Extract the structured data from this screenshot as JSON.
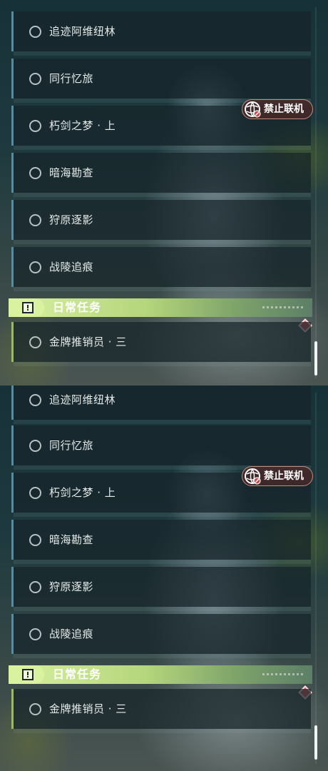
{
  "panels": [
    {
      "quests": [
        {
          "label": "追迹阿维纽林"
        },
        {
          "label": "同行忆旅"
        },
        {
          "label": "朽剑之梦 · 上"
        },
        {
          "label": "暗海勘查"
        },
        {
          "label": "狩原逐影"
        },
        {
          "label": "战陵追痕"
        }
      ],
      "badge": {
        "label": "禁止联机",
        "icon": "globe-block-icon"
      },
      "daily": {
        "title": "日常任务",
        "icon": "alert-square-icon",
        "quests": [
          {
            "label": "金牌推销员 · 三"
          }
        ]
      }
    },
    {
      "quests": [
        {
          "label": "追迹阿维纽林"
        },
        {
          "label": "同行忆旅"
        },
        {
          "label": "朽剑之梦 · 上"
        },
        {
          "label": "暗海勘查"
        },
        {
          "label": "狩原逐影"
        },
        {
          "label": "战陵追痕"
        }
      ],
      "badge": {
        "label": "禁止联机",
        "icon": "globe-block-icon"
      },
      "daily": {
        "title": "日常任务",
        "icon": "alert-square-icon",
        "quests": [
          {
            "label": "金牌推销员 · 三"
          }
        ]
      }
    }
  ],
  "colors": {
    "accent_blue": "#5b8a9a",
    "daily_green": "#b5d67c",
    "badge_border": "#c28a7c",
    "marker_red": "#e05a6a"
  }
}
